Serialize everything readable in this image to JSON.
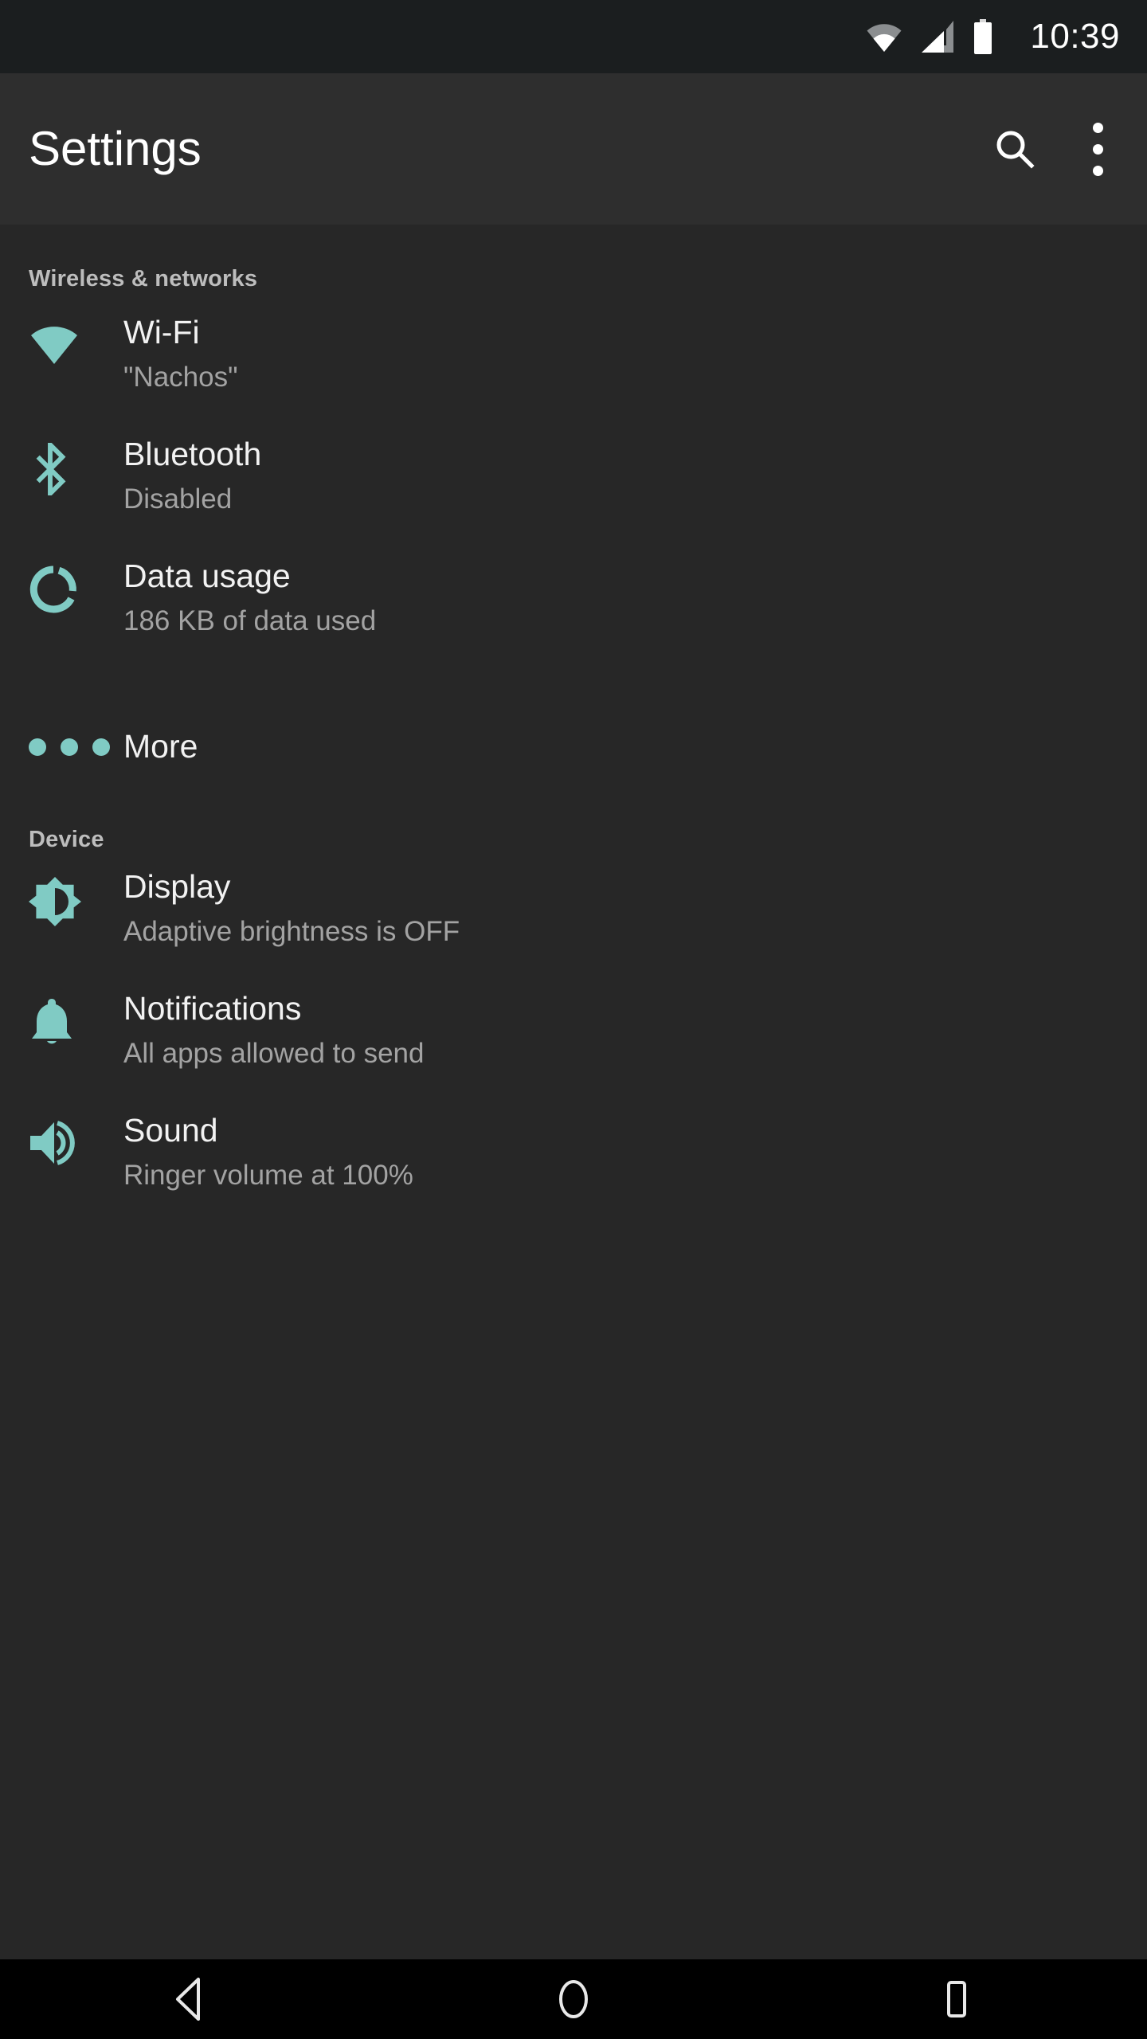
{
  "theme": {
    "accent": "#80cbc4",
    "status_bar_bg": "#1b1e1f",
    "app_bar_bg": "#2e2e2e",
    "list_bg": "#272727",
    "nav_bar_bg": "#000000",
    "title_text": "#f2f2f2",
    "sub_text": "#a3a3a3",
    "header_text": "#bdbdbd"
  },
  "status_bar": {
    "clock": "10:39",
    "icons": [
      "wifi-icon",
      "cellular-signal-icon",
      "battery-icon"
    ]
  },
  "app_bar": {
    "title": "Settings",
    "search_icon": "search-icon",
    "overflow_icon": "overflow-menu-icon"
  },
  "sections": [
    {
      "header": "Wireless & networks",
      "items": [
        {
          "icon": "wifi-icon",
          "title": "Wi-Fi",
          "subtitle": "\"Nachos\""
        },
        {
          "icon": "bluetooth-icon",
          "title": "Bluetooth",
          "subtitle": "Disabled"
        },
        {
          "icon": "data-usage-icon",
          "title": "Data usage",
          "subtitle": "186 KB of data used"
        },
        {
          "icon": "more-dots-icon",
          "title": "More",
          "subtitle": ""
        }
      ]
    },
    {
      "header": "Device",
      "items": [
        {
          "icon": "brightness-icon",
          "title": "Display",
          "subtitle": "Adaptive brightness is OFF"
        },
        {
          "icon": "notifications-icon",
          "title": "Notifications",
          "subtitle": "All apps allowed to send"
        },
        {
          "icon": "volume-up-icon",
          "title": "Sound",
          "subtitle": "Ringer volume at 100%"
        }
      ]
    }
  ],
  "nav_bar": {
    "back": "back-icon",
    "home": "home-icon",
    "recents": "recents-icon"
  }
}
